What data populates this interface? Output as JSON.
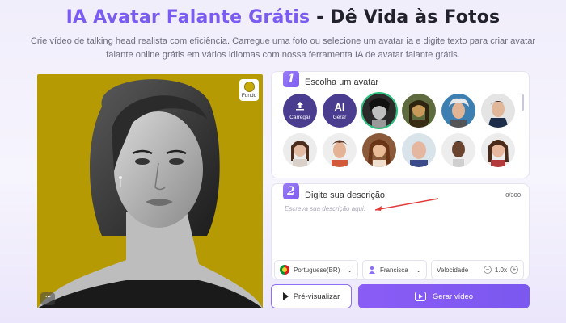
{
  "header": {
    "title_accent": "IA Avatar Falante Grátis",
    "title_rest": " - Dê Vida às Fotos",
    "subtitle": "Crie vídeo de talking head realista com eficiência. Carregue uma foto ou selecione um avatar ia e digite texto para criar avatar falante online grátis em vários idiomas com nossa ferramenta IA de avatar falante grátis."
  },
  "photo_panel": {
    "background_label": "Fundo",
    "more_label": "···"
  },
  "step1": {
    "number": "1",
    "label": "Escolha um avatar",
    "upload_label": "Carregar",
    "generate_icon_text": "AI",
    "generate_label": "Gerar"
  },
  "step2": {
    "number": "2",
    "label": "Digite sua descrição",
    "counter": "0/300",
    "placeholder": "Escreva sua descrição aqui."
  },
  "controls": {
    "language": "Portuguese(BR)",
    "voice": "Francisca",
    "speed_label": "Velocidade",
    "speed_value": "1.0x",
    "minus": "−",
    "plus": "+"
  },
  "buttons": {
    "preview": "Pré-visualizar",
    "generate": "Gerar vídeo"
  },
  "colors": {
    "accent": "#7b5cf0",
    "photo_bg": "#b69a04",
    "selected_ring": "#25c07c"
  }
}
